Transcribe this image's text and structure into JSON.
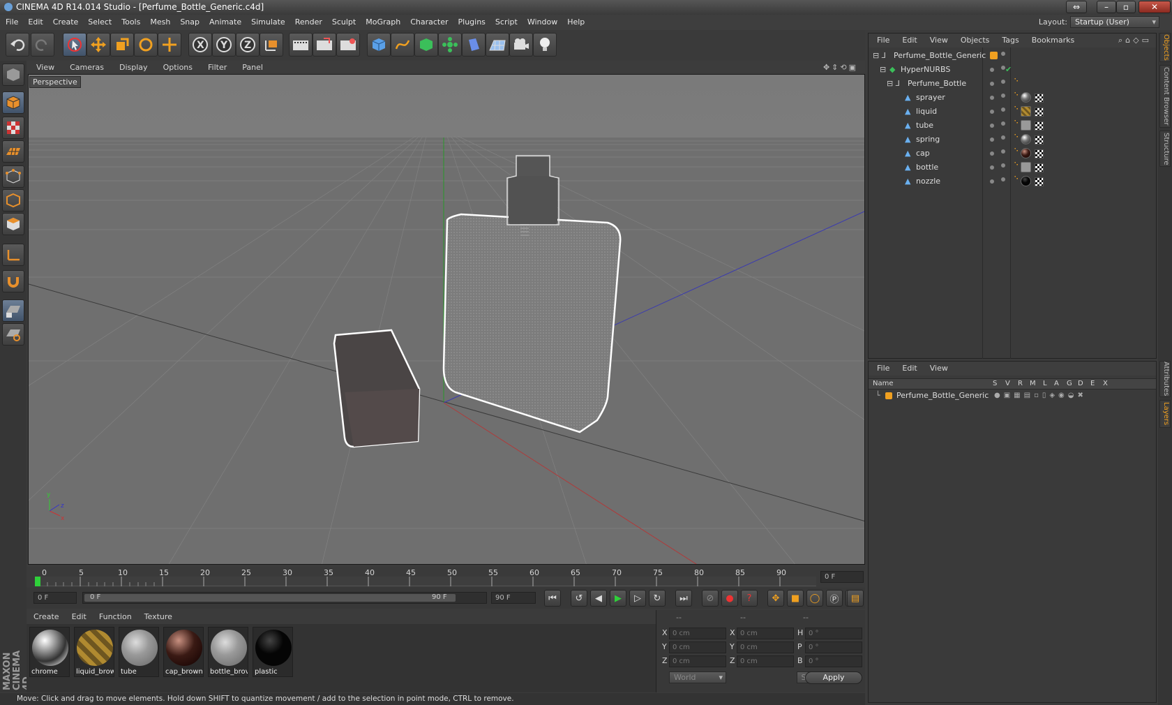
{
  "window": {
    "title": "CINEMA 4D R14.014 Studio - [Perfume_Bottle_Generic.c4d]"
  },
  "menu": [
    "File",
    "Edit",
    "Create",
    "Select",
    "Tools",
    "Mesh",
    "Snap",
    "Animate",
    "Simulate",
    "Render",
    "Sculpt",
    "MoGraph",
    "Character",
    "Plugins",
    "Script",
    "Window",
    "Help"
  ],
  "layout": {
    "label": "Layout:",
    "value": "Startup (User)"
  },
  "toolbar_icons": [
    "undo-icon",
    "redo-icon",
    "select-icon",
    "move-icon",
    "scale-icon",
    "rotate-icon",
    "live-select-icon",
    "x-axis-icon",
    "y-axis-icon",
    "z-axis-icon",
    "coord-system-icon",
    "render-view-icon",
    "render-picture-viewer-icon",
    "render-settings-icon",
    "cube-icon",
    "spline-icon",
    "nurbs-icon",
    "array-icon",
    "deformer-icon",
    "floor-icon",
    "camera-icon",
    "light-icon"
  ],
  "viewport": {
    "menu": [
      "View",
      "Cameras",
      "Display",
      "Options",
      "Filter",
      "Panel"
    ],
    "label": "Perspective"
  },
  "timeline": {
    "ticks": [
      "0",
      "5",
      "10",
      "15",
      "20",
      "25",
      "30",
      "35",
      "40",
      "45",
      "50",
      "55",
      "60",
      "65",
      "70",
      "75",
      "80",
      "85",
      "90"
    ],
    "current_frame": "0 F"
  },
  "controls": {
    "start": "0 F",
    "range_start": "0 F",
    "range_end": "90 F",
    "end": "90 F"
  },
  "materials": {
    "menu": [
      "Create",
      "Edit",
      "Function",
      "Texture"
    ],
    "items": [
      {
        "name": "chrome"
      },
      {
        "name": "liquid_brow"
      },
      {
        "name": "tube"
      },
      {
        "name": "cap_brown"
      },
      {
        "name": "bottle_brov"
      },
      {
        "name": "plastic"
      }
    ]
  },
  "coords": {
    "headers": [
      "--",
      "--",
      "--"
    ],
    "rows": [
      {
        "a": "X",
        "av": "0 cm",
        "b": "X",
        "bv": "0 cm",
        "c": "H",
        "cv": "0 °"
      },
      {
        "a": "Y",
        "av": "0 cm",
        "b": "Y",
        "bv": "0 cm",
        "c": "P",
        "cv": "0 °"
      },
      {
        "a": "Z",
        "av": "0 cm",
        "b": "Z",
        "bv": "0 cm",
        "c": "B",
        "cv": "0 °"
      }
    ],
    "mode1": "World",
    "mode2": "Scale",
    "apply": "Apply"
  },
  "status": "Move: Click and drag to move elements. Hold down SHIFT to quantize movement / add to the selection in point mode, CTRL to remove.",
  "objects": {
    "menu": [
      "File",
      "Edit",
      "View",
      "Objects",
      "Tags",
      "Bookmarks"
    ],
    "items": [
      {
        "name": "Perfume_Bottle_Generic"
      },
      {
        "name": "HyperNURBS"
      },
      {
        "name": "Perfume_Bottle"
      },
      {
        "name": "sprayer"
      },
      {
        "name": "liquid"
      },
      {
        "name": "tube"
      },
      {
        "name": "spring"
      },
      {
        "name": "cap"
      },
      {
        "name": "bottle"
      },
      {
        "name": "nozzle"
      }
    ]
  },
  "layers": {
    "menu": [
      "File",
      "Edit",
      "View"
    ],
    "columns": [
      "Name",
      "S",
      "V",
      "R",
      "M",
      "L",
      "A",
      "G",
      "D",
      "E",
      "X"
    ],
    "item": "Perfume_Bottle_Generic"
  },
  "sidetabs": [
    "Objects",
    "Content Browser",
    "Structure",
    "Attributes",
    "Layers"
  ],
  "brand": "MAXON CINEMA 4D"
}
